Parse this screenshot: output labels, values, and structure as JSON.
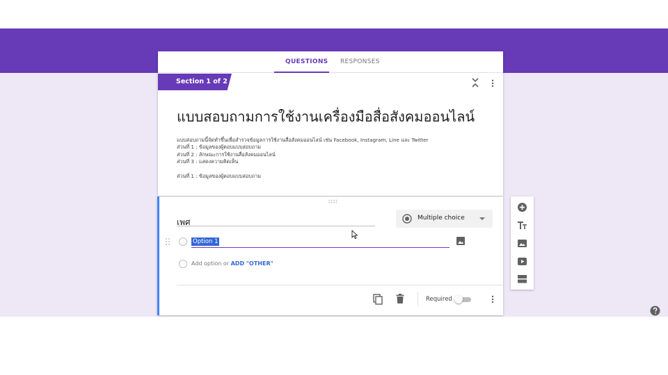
{
  "tabs": [
    {
      "label": "QUESTIONS",
      "active": true
    },
    {
      "label": "RESPONSES",
      "active": false
    }
  ],
  "section": {
    "label": "Section 1 of 2"
  },
  "form": {
    "title": "แบบสอบถามการใช้งานเครื่องมือสื่อสังคมออนไลน์",
    "description_lines": [
      "แบบสอบถามนี้จัดทำขึ้นเพื่อสำรวจข้อมูลการใช้งานสื่อสังคมออนไลน์ เช่น Facebook, Instagram, Line และ Twitter",
      "ส่วนที่ 1 : ข้อมูลของผู้ตอบแบบสอบถาม",
      "ส่วนที่ 2 : ลักษณะการใช้งานสื่อสังคมออนไลน์",
      "ส่วนที่ 3 : แสดงความคิดเห็น",
      "",
      "ส่วนที่ 1 : ข้อมูลของผู้ตอบแบบสอบถาม"
    ]
  },
  "question": {
    "title": "เพศ",
    "type_label": "Multiple choice",
    "option1": "Option 1",
    "add_option": "Add option",
    "or": "or",
    "add_other": "ADD \"OTHER\"",
    "required_label": "Required",
    "required": false
  },
  "colors": {
    "accent": "#673ab7",
    "background": "#ede7f6",
    "focus": "#4285f4",
    "link": "#3367d6"
  },
  "icons": {
    "toolbar": [
      "add-question-icon",
      "add-title-icon",
      "add-image-icon",
      "add-video-icon",
      "add-section-icon"
    ]
  }
}
